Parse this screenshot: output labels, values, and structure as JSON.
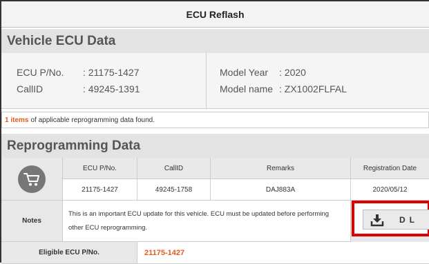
{
  "window": {
    "title": "ECU Reflash"
  },
  "vehicle_section": {
    "heading": "Vehicle ECU Data",
    "ecu_pno_label": "ECU P/No.",
    "ecu_pno_value": ": 21175-1427",
    "callid_label": "CallID",
    "callid_value": ": 49245-1391",
    "model_year_label": "Model Year",
    "model_year_value": ": 2020",
    "model_name_label": "Model name",
    "model_name_value": ": ZX1002FLFAL"
  },
  "found_message": {
    "count_text": "1 items",
    "rest_text": "of applicable reprogramming data found."
  },
  "reprogramming": {
    "heading": "Reprogramming Data",
    "columns": [
      "ECU P/No.",
      "CallID",
      "Remarks",
      "Registration Date"
    ],
    "row": {
      "ecu_pno": "21175-1427",
      "callid": "49245-1758",
      "remarks": "DAJ883A",
      "registration_date": "2020/05/12"
    },
    "notes_label": "Notes",
    "notes_line1": "This is an important ECU update for this vehicle. ECU must be updated before performing",
    "notes_line2": "other ECU reprogramming.",
    "download_label": "DL",
    "eligible_label": "Eligible ECU P/No.",
    "eligible_value": "21175-1427"
  },
  "icons": {
    "cart": "shopping-cart-icon",
    "download": "download-icon"
  },
  "colors": {
    "accent": "#e05a1a",
    "highlight_box": "#e00000",
    "section_bg": "#e3e3e3"
  }
}
